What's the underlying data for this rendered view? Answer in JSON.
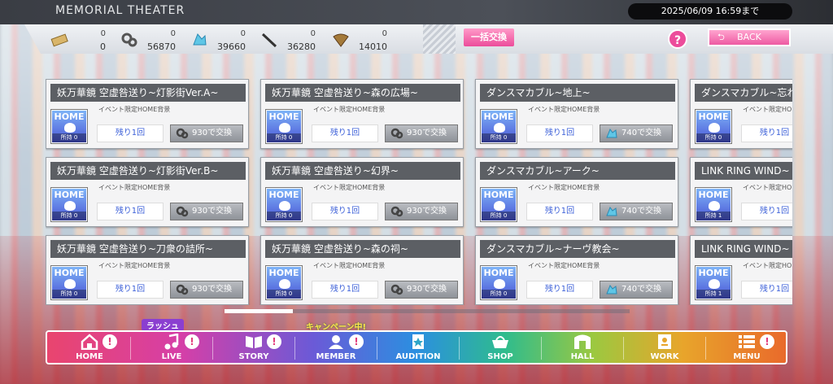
{
  "header": {
    "title": "MEMORIAL THEATER",
    "deadline": "2025/06/09 16:59まで",
    "bulk_exchange": "一括交換",
    "help": "?",
    "back": "BACK"
  },
  "resources": [
    {
      "icon": "ticket-icon",
      "top": "0",
      "bottom": "0"
    },
    {
      "icon": "ring-link-icon",
      "top": "0",
      "bottom": "56870"
    },
    {
      "icon": "blue-crystal-icon",
      "top": "0",
      "bottom": "39660"
    },
    {
      "icon": "wand-icon",
      "top": "0",
      "bottom": "36280"
    },
    {
      "icon": "feather-fan-icon",
      "top": "0",
      "bottom": "14010"
    }
  ],
  "cards": [
    {
      "name": "妖万華鏡 空虚咎送り~灯影街Ver.A~",
      "desc": "イベント限定HOME背景",
      "owned": "所持 0",
      "remain": "残り1回",
      "exchange": "930で交換",
      "currency": "ring-link-icon"
    },
    {
      "name": "妖万華鏡 空虚咎送り~森の広場~",
      "desc": "イベント限定HOME背景",
      "owned": "所持 0",
      "remain": "残り1回",
      "exchange": "930で交換",
      "currency": "ring-link-icon"
    },
    {
      "name": "ダンスマカブル~地上~",
      "desc": "イベント限定HOME背景",
      "owned": "所持 0",
      "remain": "残り1回",
      "exchange": "740で交換",
      "currency": "blue-crystal-icon"
    },
    {
      "name": "ダンスマカブル~忘れら",
      "desc": "イベント限定HOME背景",
      "owned": "所持 0",
      "remain": "残り1回",
      "exchange": "",
      "currency": ""
    },
    {
      "name": "妖万華鏡 空虚咎送り~灯影街Ver.B~",
      "desc": "イベント限定HOME背景",
      "owned": "所持 0",
      "remain": "残り1回",
      "exchange": "930で交換",
      "currency": "ring-link-icon"
    },
    {
      "name": "妖万華鏡 空虚咎送り~幻界~",
      "desc": "イベント限定HOME背景",
      "owned": "所持 0",
      "remain": "残り1回",
      "exchange": "930で交換",
      "currency": "ring-link-icon"
    },
    {
      "name": "ダンスマカブル~アーク~",
      "desc": "イベント限定HOME背景",
      "owned": "所持 0",
      "remain": "残り1回",
      "exchange": "740で交換",
      "currency": "blue-crystal-icon"
    },
    {
      "name": "LINK RING WIND~",
      "desc": "イベント限定HOME背景",
      "owned": "所持 1",
      "remain": "残り1回",
      "exchange": "",
      "currency": ""
    },
    {
      "name": "妖万華鏡 空虚咎送り~刀衆の詰所~",
      "desc": "イベント限定HOME背景",
      "owned": "所持 0",
      "remain": "残り1回",
      "exchange": "930で交換",
      "currency": "ring-link-icon"
    },
    {
      "name": "妖万華鏡 空虚咎送り~森の祠~",
      "desc": "イベント限定HOME背景",
      "owned": "所持 0",
      "remain": "残り1回",
      "exchange": "930で交換",
      "currency": "ring-link-icon"
    },
    {
      "name": "ダンスマカブル~ナーヴ教会~",
      "desc": "イベント限定HOME背景",
      "owned": "所持 0",
      "remain": "残り1回",
      "exchange": "740で交換",
      "currency": "blue-crystal-icon"
    },
    {
      "name": "LINK RING WIND~",
      "desc": "イベント限定HOME背景",
      "owned": "所持 1",
      "remain": "残り1回",
      "exchange": "",
      "currency": ""
    }
  ],
  "thumb_label": "HOME",
  "nav": {
    "tags": {
      "rush": "ラッシュ",
      "campaign": "キャンペーン中!"
    },
    "items": [
      {
        "label": "HOME",
        "icon": "home-icon",
        "badge": "!"
      },
      {
        "label": "LIVE",
        "icon": "music-note-icon",
        "badge": "!"
      },
      {
        "label": "STORY",
        "icon": "book-icon",
        "badge": "!"
      },
      {
        "label": "MEMBER",
        "icon": "member-icon",
        "badge": "!"
      },
      {
        "label": "AUDITION",
        "icon": "audition-icon",
        "badge": ""
      },
      {
        "label": "SHOP",
        "icon": "basket-icon",
        "badge": ""
      },
      {
        "label": "HALL",
        "icon": "hall-icon",
        "badge": ""
      },
      {
        "label": "WORK",
        "icon": "work-icon",
        "badge": ""
      },
      {
        "label": "MENU",
        "icon": "menu-list-icon",
        "badge": "!"
      }
    ]
  },
  "colors": {
    "accent_pink": "#ec4c9b",
    "remain_text": "#3b5fd8",
    "card_header": "#5c5f64"
  }
}
